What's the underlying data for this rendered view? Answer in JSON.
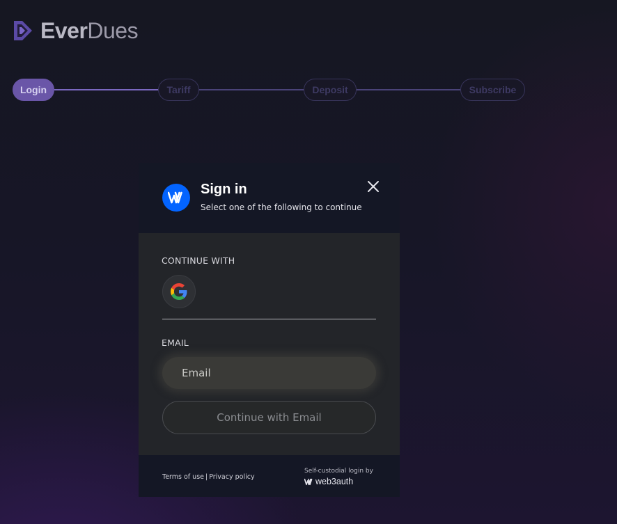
{
  "brand": {
    "name_part1": "Ever",
    "name_part2": "Dues",
    "logo_icon": "everdues-play-logo-icon",
    "logo_color": "#6a56b8"
  },
  "stepper": {
    "steps": [
      {
        "label": "Login",
        "state": "active"
      },
      {
        "label": "Tariff",
        "state": "inactive"
      },
      {
        "label": "Deposit",
        "state": "inactive"
      },
      {
        "label": "Subscribe",
        "state": "inactive"
      }
    ],
    "active_color": "#6a56a8"
  },
  "modal": {
    "title": "Sign in",
    "subtitle": "Select one of the following to continue",
    "badge_icon": "web3auth-w-icon",
    "badge_color": "#0364ff",
    "close_icon": "close-icon",
    "continue_with_label": "CONTINUE WITH",
    "social_providers": [
      {
        "name": "google",
        "icon": "google-g-icon"
      }
    ],
    "email_label": "EMAIL",
    "email_input": {
      "value": "",
      "placeholder": "Email"
    },
    "continue_button_label": "Continue with Email",
    "footer": {
      "terms_label": "Terms of use",
      "separator": "|",
      "privacy_label": "Privacy policy",
      "powered_by_text": "Self-custodial login by",
      "powered_by_brand": "web3auth",
      "powered_by_icon": "web3auth-w-icon"
    }
  }
}
